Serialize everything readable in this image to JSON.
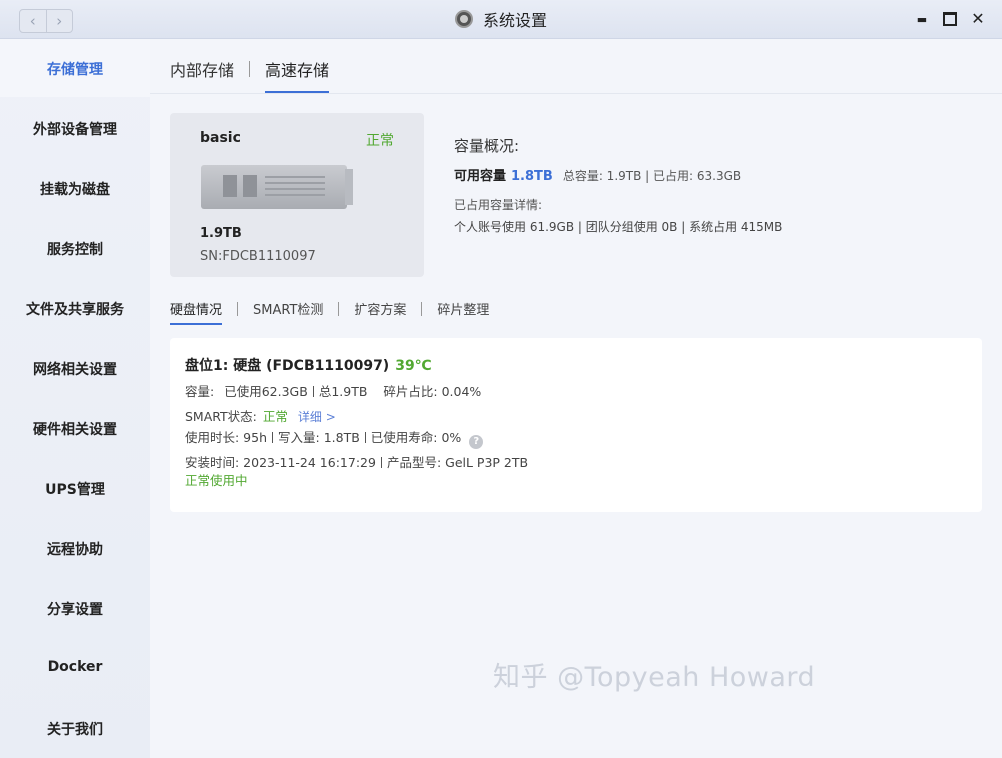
{
  "window": {
    "title": "系统设置",
    "nav_back": "‹",
    "nav_forward": "›",
    "minimize": "▬",
    "close": "✕"
  },
  "sidebar": {
    "items": [
      {
        "label": "存储管理",
        "active": true
      },
      {
        "label": "外部设备管理"
      },
      {
        "label": "挂载为磁盘"
      },
      {
        "label": "服务控制"
      },
      {
        "label": "文件及共享服务"
      },
      {
        "label": "网络相关设置"
      },
      {
        "label": "硬件相关设置"
      },
      {
        "label": "UPS管理"
      },
      {
        "label": "远程协助"
      },
      {
        "label": "分享设置"
      },
      {
        "label": "Docker"
      },
      {
        "label": "关于我们"
      }
    ]
  },
  "tabs": [
    {
      "label": "内部存储"
    },
    {
      "label": "高速存储",
      "active": true
    }
  ],
  "disk": {
    "name": "basic",
    "status": "正常",
    "size": "1.9TB",
    "sn": "SN:FDCB1110097"
  },
  "capacity": {
    "title": "容量概况:",
    "available_label": "可用容量",
    "available_value": "1.8TB",
    "summary": "总容量: 1.9TB | 已占用: 63.3GB",
    "detail_title": "已占用容量详情:",
    "detail": "个人账号使用 61.9GB | 团队分组使用 0B | 系统占用 415MB"
  },
  "subtabs": [
    {
      "label": "硬盘情况",
      "active": true
    },
    {
      "label": "SMART检测"
    },
    {
      "label": "扩容方案"
    },
    {
      "label": "碎片整理"
    }
  ],
  "drive": {
    "slot_title": "盘位1: 硬盘 (FDCB1110097)",
    "temperature": "39℃",
    "capacity_label": "容量:",
    "used": "已使用62.3GB",
    "total": "总1.9TB",
    "fragment": "碎片占比: 0.04%",
    "smart_label": "SMART状态:",
    "smart_status": "正常",
    "smart_detail": "详细 >",
    "uptime": "使用时长: 95h",
    "written": "写入量: 1.8TB",
    "life": "已使用寿命: 0%",
    "help_icon": "?",
    "install_time": "安装时间: 2023-11-24 16:17:29",
    "model": "产品型号: GelL P3P 2TB",
    "in_use": "正常使用中"
  },
  "watermark": "知乎 @Topyeah Howard",
  "colors": {
    "accent": "#3c6fd6",
    "ok_green": "#52a832"
  }
}
